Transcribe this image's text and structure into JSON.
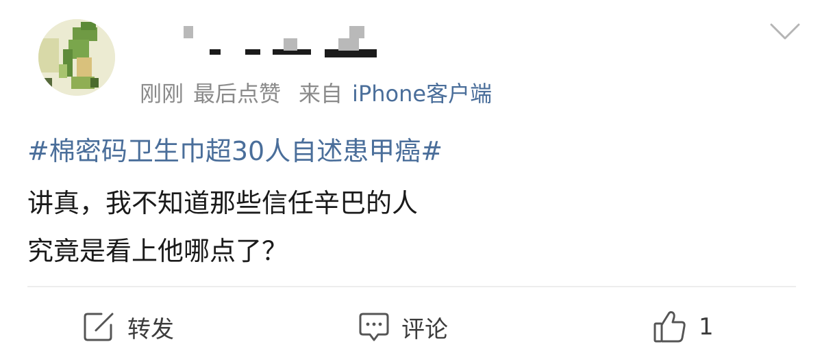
{
  "header": {
    "time": "刚刚",
    "last_like": "最后点赞",
    "source_prefix": "来自",
    "source": "iPhone客户端"
  },
  "post": {
    "topic": "#棉密码卫生巾超30人自述患甲癌#",
    "lines": [
      "讲真，我不知道那些信任辛巴的人",
      "究竟是看上他哪点了？"
    ]
  },
  "actions": {
    "repost_label": "转发",
    "comment_label": "评论",
    "like_count": "1"
  },
  "icons": {
    "menu": "chevron-down-icon",
    "repost": "share-edit-icon",
    "comment": "comment-icon",
    "like": "thumbs-up-icon"
  },
  "colors": {
    "link": "#4a6e9a",
    "meta": "#8a8a8a",
    "text": "#1a1a1a",
    "icon": "#555555"
  }
}
